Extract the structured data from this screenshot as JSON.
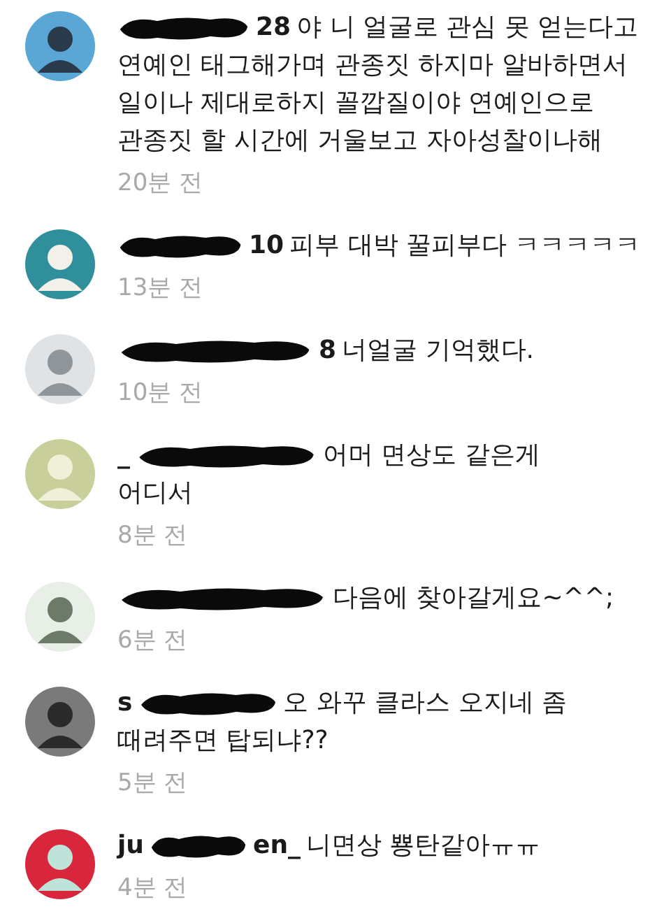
{
  "comments": [
    {
      "user_suffix": "28",
      "lines": [
        "야 니 얼굴로 관심 못 얻는다고",
        "연예인 태그해가며 관종짓 하지마 알바하면서",
        "일이나 제대로하지 꼴깝질이야 연예인으로",
        "관종짓 할 시간에 거울보고 자아성찰이나해"
      ],
      "time": "20분 전"
    },
    {
      "user_suffix": "10",
      "lines": [
        "피부 대박 꿀피부다 ㅋㅋㅋㅋㅋ"
      ],
      "time": "13분 전"
    },
    {
      "user_suffix": "8",
      "lines": [
        "너얼굴 기억했다."
      ],
      "time": "10분 전"
    },
    {
      "user_prefix": "_",
      "lines": [
        "어머 면상도 같은게",
        "어디서"
      ],
      "time": "8분 전"
    },
    {
      "lines": [
        "다음에 찾아갈게요~^^;"
      ],
      "time": "6분 전"
    },
    {
      "user_prefix": "s",
      "lines": [
        "오 와꾸 클라스 오지네 좀",
        "때려주면 탑되냐??"
      ],
      "time": "5분 전"
    },
    {
      "user_prefix": "ju",
      "user_suffix": "en_",
      "lines": [
        "니면상 뿅탄같아ㅠㅠ"
      ],
      "time": "4분 전"
    }
  ]
}
